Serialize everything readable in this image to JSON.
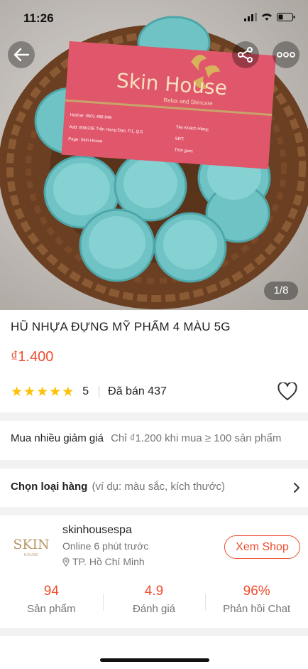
{
  "status_bar": {
    "time": "11:26"
  },
  "gallery": {
    "counter": "1/8"
  },
  "product": {
    "title": "HŨ NHỰA ĐỰNG MỸ PHẨM 4 MÀU 5G",
    "price": "₫1.400",
    "rating_value": "5",
    "rating_stars": 5,
    "sold": "Đã bán 437"
  },
  "bulk_discount": {
    "label": "Mua nhiều giảm giá",
    "text": "Chỉ ₫1.200 khi mua ≥ 100 sản phẩm"
  },
  "variant": {
    "label": "Chọn loại hàng",
    "hint": "(ví dụ: màu sắc, kích thước)"
  },
  "card_in_photo": {
    "brand": "Skin House",
    "tagline": "Relax and Skincare",
    "hotline": "Hotline: 0901 488 949",
    "address": "Add: 809/23E Trần Hưng Đạo, P.1, Q.5",
    "page": "Page: Skin House",
    "customer": "Tên Khách Hàng:",
    "phone": "SĐT:",
    "time": "Thời gian:"
  },
  "shop": {
    "logo_text": "SKIN",
    "logo_sub": "HOUSE",
    "name": "skinhousespa",
    "online": "Online 6 phút trước",
    "location": "TP. Hồ Chí Minh",
    "view_button": "Xem Shop"
  },
  "stats": [
    {
      "value": "94",
      "label": "Sản phẩm"
    },
    {
      "value": "4.9",
      "label": "Đánh giá"
    },
    {
      "value": "96%",
      "label": "Phản hồi Chat"
    }
  ],
  "colors": {
    "accent": "#ee4d2d",
    "star": "#ffc107",
    "jar": "#6fc3c4",
    "card": "#e0566a"
  },
  "icons": [
    "back-arrow-icon",
    "share-icon",
    "more-icon",
    "heart-icon",
    "chevron-right-icon",
    "location-pin-icon",
    "signal-icon",
    "wifi-icon",
    "battery-icon"
  ]
}
